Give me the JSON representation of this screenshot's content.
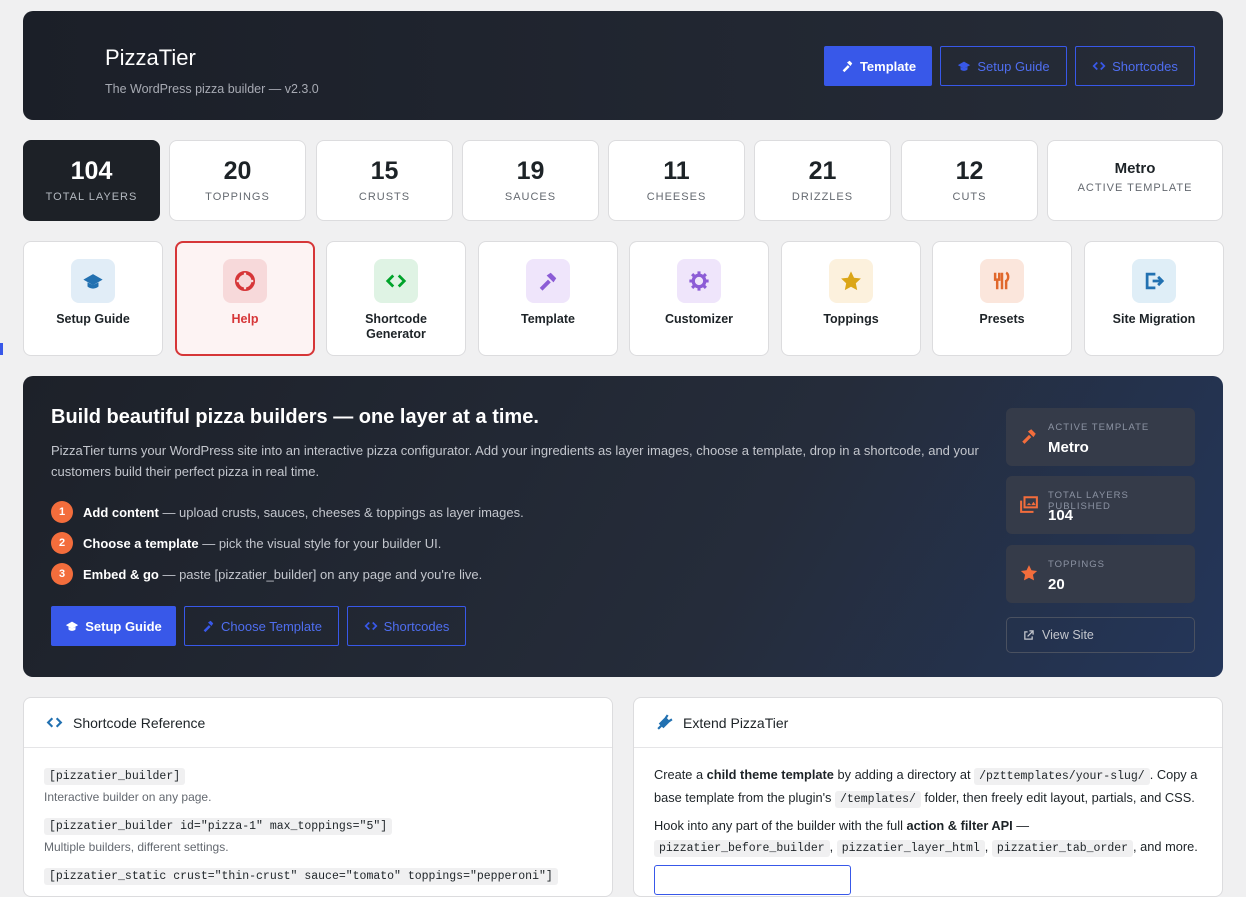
{
  "header": {
    "title": "PizzaTier",
    "subtitle": "The WordPress pizza builder — v2.3.0",
    "buttons": [
      {
        "label": "Template",
        "icon": "hammer-icon",
        "style": "primary"
      },
      {
        "label": "Setup Guide",
        "icon": "graduation-cap-icon",
        "style": "outline"
      },
      {
        "label": "Shortcodes",
        "icon": "code-icon",
        "style": "outline"
      }
    ]
  },
  "stats": [
    {
      "value": "104",
      "label": "TOTAL LAYERS"
    },
    {
      "value": "20",
      "label": "TOPPINGS"
    },
    {
      "value": "15",
      "label": "CRUSTS"
    },
    {
      "value": "19",
      "label": "SAUCES"
    },
    {
      "value": "11",
      "label": "CHEESES"
    },
    {
      "value": "21",
      "label": "DRIZZLES"
    },
    {
      "value": "12",
      "label": "CUTS"
    },
    {
      "value": "Metro",
      "label": "ACTIVE TEMPLATE"
    }
  ],
  "tiles": [
    {
      "label": "Setup Guide",
      "icon": "graduation-cap-icon",
      "color": "#2271b1"
    },
    {
      "label": "Help",
      "icon": "lifebuoy-icon",
      "color": "#d63638"
    },
    {
      "label": "Shortcode Generator",
      "icon": "code-icon",
      "color": "#00a32a"
    },
    {
      "label": "Template",
      "icon": "hammer-icon",
      "color": "#8c5cd6"
    },
    {
      "label": "Customizer",
      "icon": "gear-icon",
      "color": "#8c5cd6"
    },
    {
      "label": "Toppings",
      "icon": "star-icon",
      "color": "#dba617"
    },
    {
      "label": "Presets",
      "icon": "utensils-icon",
      "color": "#e0682c"
    },
    {
      "label": "Site Migration",
      "icon": "sign-out-icon",
      "color": "#2271b1"
    }
  ],
  "hero": {
    "title": "Build beautiful pizza builders — one layer at a time.",
    "description": "PizzaTier turns your WordPress site into an interactive pizza configurator. Add your ingredients as layer images, choose a template, drop in a shortcode, and your customers build their perfect pizza in real time.",
    "steps": [
      {
        "num": "1",
        "bold": "Add content",
        "text": " — upload crusts, sauces, cheeses & toppings as layer images."
      },
      {
        "num": "2",
        "bold": "Choose a template",
        "text": " — pick the visual style for your builder UI."
      },
      {
        "num": "3",
        "bold": "Embed & go",
        "text": " — paste [pizzatier_builder] on any page and you're live."
      }
    ],
    "buttons": [
      {
        "label": "Setup Guide",
        "icon": "graduation-cap-icon"
      },
      {
        "label": "Choose Template",
        "icon": "hammer-icon"
      },
      {
        "label": "Shortcodes",
        "icon": "code-icon"
      }
    ],
    "side": [
      {
        "label": "ACTIVE TEMPLATE",
        "value": "Metro",
        "icon": "hammer-icon"
      },
      {
        "label": "TOTAL LAYERS PUBLISHED",
        "value": "104",
        "icon": "images-icon"
      },
      {
        "label": "TOPPINGS",
        "value": "20",
        "icon": "star-icon"
      }
    ],
    "view_site": "View Site"
  },
  "shortcode_ref": {
    "title": "Shortcode Reference",
    "items": [
      {
        "code": "[pizzatier_builder]",
        "desc": "Interactive builder on any page."
      },
      {
        "code": "[pizzatier_builder id=\"pizza-1\" max_toppings=\"5\"]",
        "desc": "Multiple builders, different settings."
      },
      {
        "code": "[pizzatier_static crust=\"thin-crust\" sauce=\"tomato\" toppings=\"pepperoni\"]",
        "desc": ""
      }
    ]
  },
  "extend": {
    "title": "Extend PizzaTier",
    "p1_a": "Create a ",
    "p1_b": "child theme template",
    "p1_c": " by adding a directory at ",
    "p1_code1": "/pzttemplates/your-slug/",
    "p1_d": ". Copy a base template from the plugin's ",
    "p1_code2": "/templates/",
    "p1_e": " folder, then freely edit layout, partials, and CSS.",
    "p2_a": "Hook into any part of the builder with the full ",
    "p2_b": "action & filter API",
    "p2_c": " —",
    "p2_code1": "pizzatier_before_builder",
    "p2_code2": "pizzatier_layer_html",
    "p2_code3": "pizzatier_tab_order",
    "p2_d": ", and more."
  }
}
